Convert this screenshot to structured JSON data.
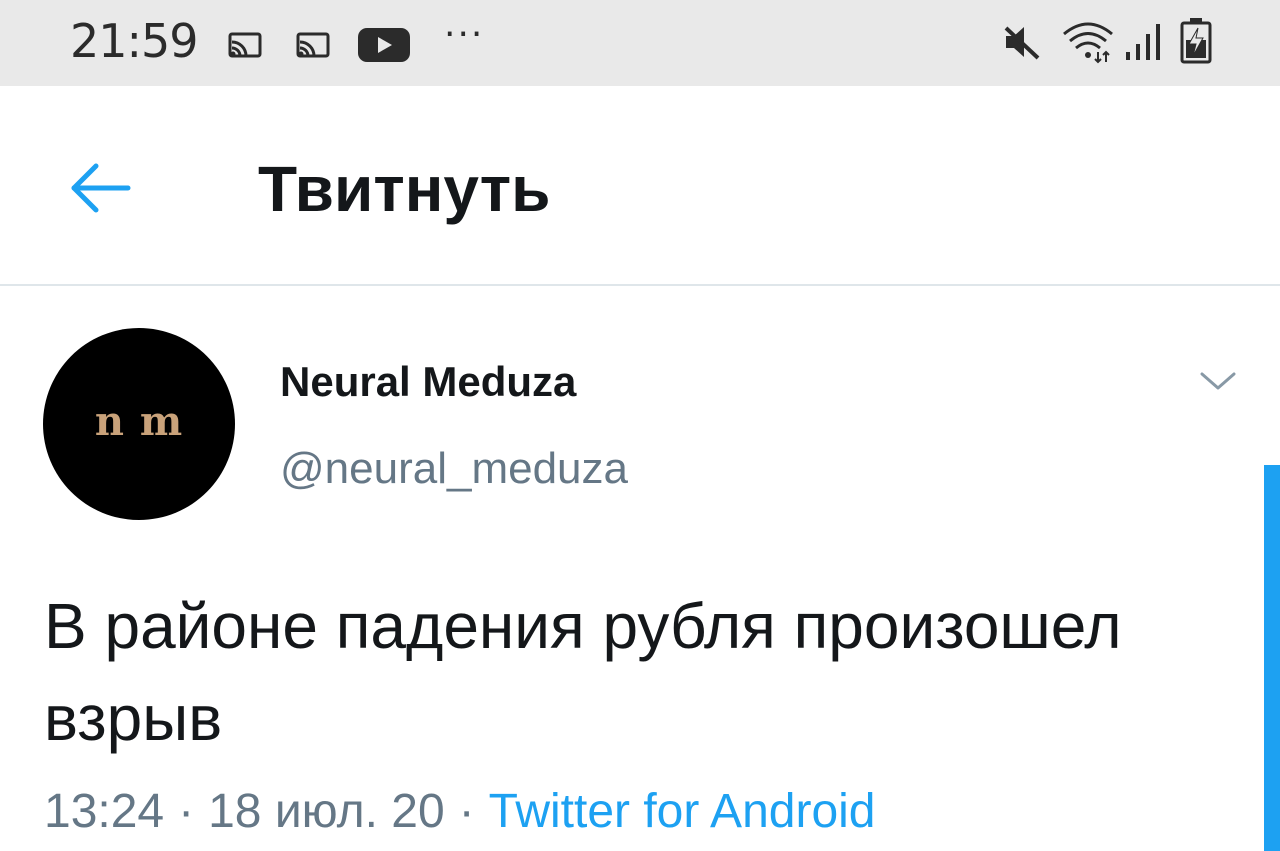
{
  "status_bar": {
    "time": "21:59",
    "more": "···",
    "icons": [
      "cast-icon",
      "cast-icon",
      "youtube-icon",
      "mute-icon",
      "wifi-icon",
      "signal-icon",
      "battery-icon"
    ]
  },
  "header": {
    "back_icon": "arrow-left-icon",
    "title": "Твитнуть"
  },
  "tweet": {
    "avatar_text": "n m",
    "display_name": "Neural Meduza",
    "handle": "@neural_meduza",
    "text": "В районе падения рубля произошел взрыв",
    "time": "13:24",
    "date": "18 июл. 20",
    "separator": "·",
    "source": "Twitter for Android"
  },
  "colors": {
    "accent": "#1da1f2",
    "text_primary": "#14171a",
    "text_secondary": "#657786",
    "status_bar_bg": "#e9e9e9",
    "avatar_bg": "#000000",
    "avatar_text": "#c9a27a"
  }
}
